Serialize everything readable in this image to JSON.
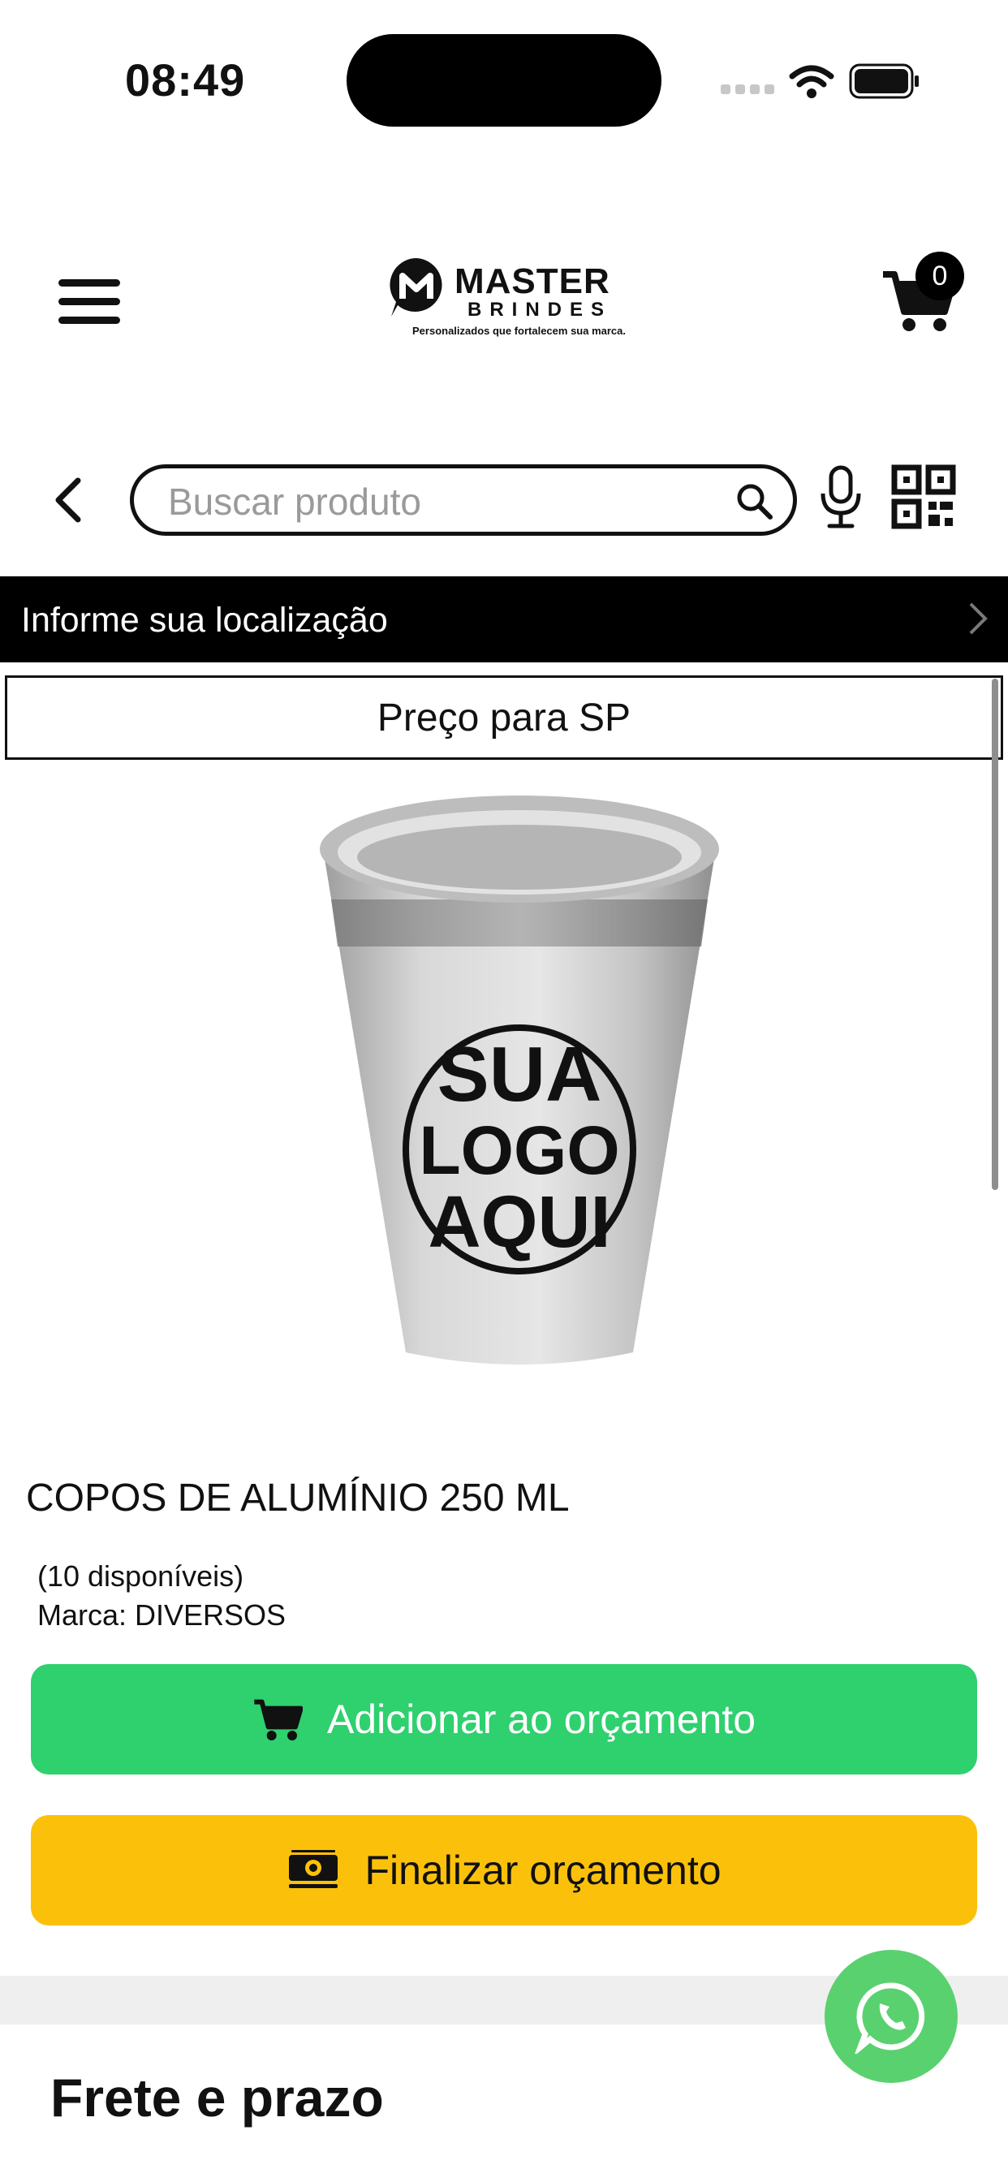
{
  "status_bar": {
    "time": "08:49"
  },
  "header": {
    "logo_title": "MASTER",
    "logo_subtitle": "BRINDES",
    "logo_tagline": "Personalizados que fortalecem sua marca.",
    "cart_count": "0"
  },
  "search": {
    "placeholder": "Buscar produto"
  },
  "location": {
    "label": "Informe sua localização"
  },
  "price_region": {
    "label": "Preço para SP"
  },
  "product": {
    "image_text": [
      "SUA",
      "LOGO",
      "AQUI"
    ],
    "title": "COPOS DE ALUMÍNIO 250 ML",
    "availability": "(10 disponíveis)",
    "brand": "Marca: DIVERSOS"
  },
  "actions": {
    "add_label": "Adicionar ao orçamento",
    "finish_label": "Finalizar orçamento"
  },
  "shipping": {
    "heading": "Frete e prazo"
  },
  "colors": {
    "green": "#2fd06e",
    "yellow": "#fbc10a",
    "whatsapp": "#59d16f"
  }
}
